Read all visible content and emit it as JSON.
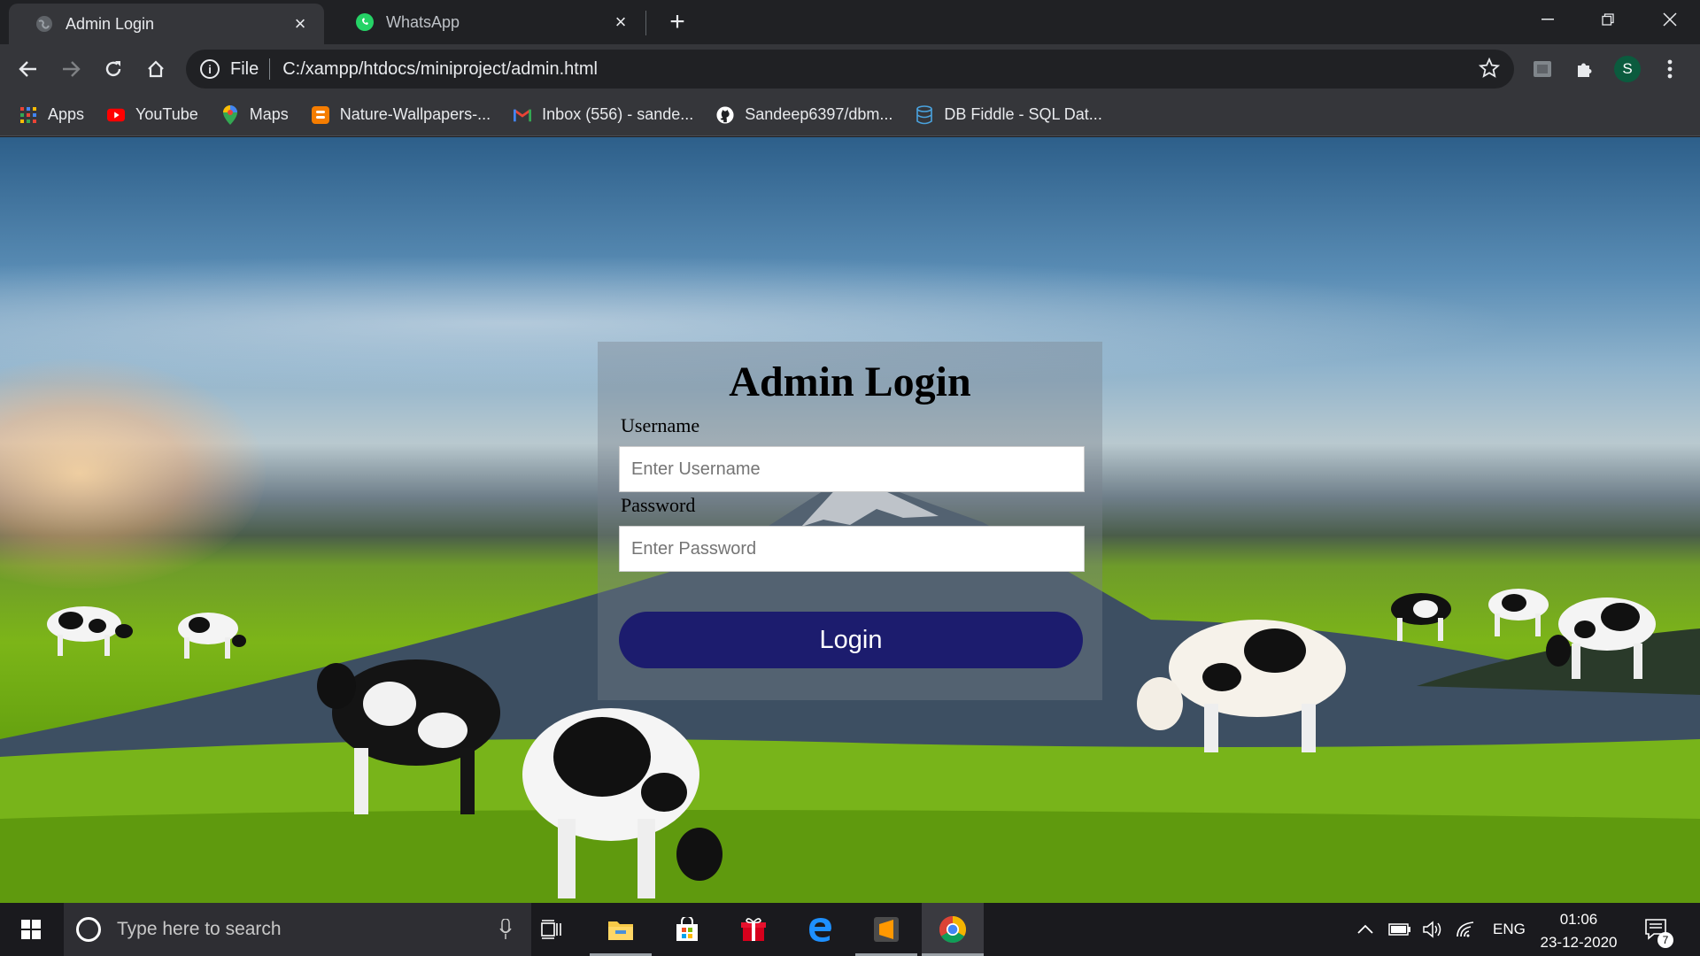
{
  "browser": {
    "tabs": [
      {
        "title": "Admin Login",
        "active": true,
        "icon": "globe-icon"
      },
      {
        "title": "WhatsApp",
        "active": false,
        "icon": "whatsapp-icon"
      }
    ],
    "url_scheme": "File",
    "url": "C:/xampp/htdocs/miniproject/admin.html",
    "profile_initial": "S"
  },
  "bookmarks": [
    {
      "label": "Apps",
      "icon": "apps-grid-icon"
    },
    {
      "label": "YouTube",
      "icon": "youtube-icon"
    },
    {
      "label": "Maps",
      "icon": "maps-pin-icon"
    },
    {
      "label": "Nature-Wallpapers-...",
      "icon": "blogger-icon"
    },
    {
      "label": "Inbox (556) - sande...",
      "icon": "gmail-icon"
    },
    {
      "label": "Sandeep6397/dbm...",
      "icon": "github-icon"
    },
    {
      "label": "DB Fiddle - SQL Dat...",
      "icon": "database-icon"
    }
  ],
  "login": {
    "heading": "Admin Login",
    "username_label": "Username",
    "username_placeholder": "Enter Username",
    "password_label": "Password",
    "password_placeholder": "Enter Password",
    "button_label": "Login"
  },
  "taskbar": {
    "search_placeholder": "Type here to search",
    "language": "ENG",
    "time": "01:06",
    "date": "23-12-2020",
    "notification_count": "7"
  },
  "colors": {
    "login_button": "#1c1c6e",
    "chrome_dark": "#202124",
    "chrome_toolbar": "#35363a"
  }
}
